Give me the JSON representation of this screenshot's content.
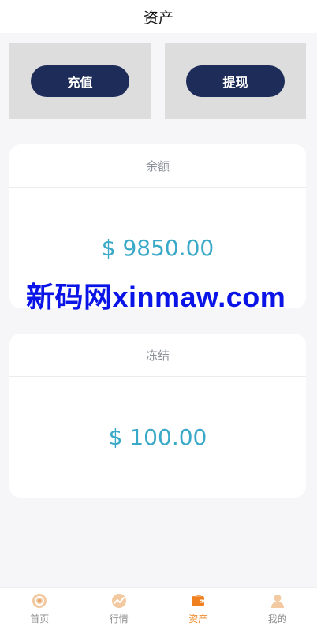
{
  "header": {
    "title": "资产"
  },
  "actions": {
    "recharge": "充值",
    "withdraw": "提现"
  },
  "balance": {
    "label": "余额",
    "amount": "$ 9850.00"
  },
  "frozen": {
    "label": "冻结",
    "amount": "$ 100.00"
  },
  "watermark": "新码网xinmaw.com",
  "tabbar": {
    "items": [
      {
        "label": "首页",
        "icon": "home-icon"
      },
      {
        "label": "行情",
        "icon": "market-icon"
      },
      {
        "label": "资产",
        "icon": "wallet-icon",
        "active": true
      },
      {
        "label": "我的",
        "icon": "user-icon"
      }
    ]
  },
  "colors": {
    "accent": "#f08a2a",
    "button": "#1d2c58",
    "amount": "#3aa9c8"
  }
}
